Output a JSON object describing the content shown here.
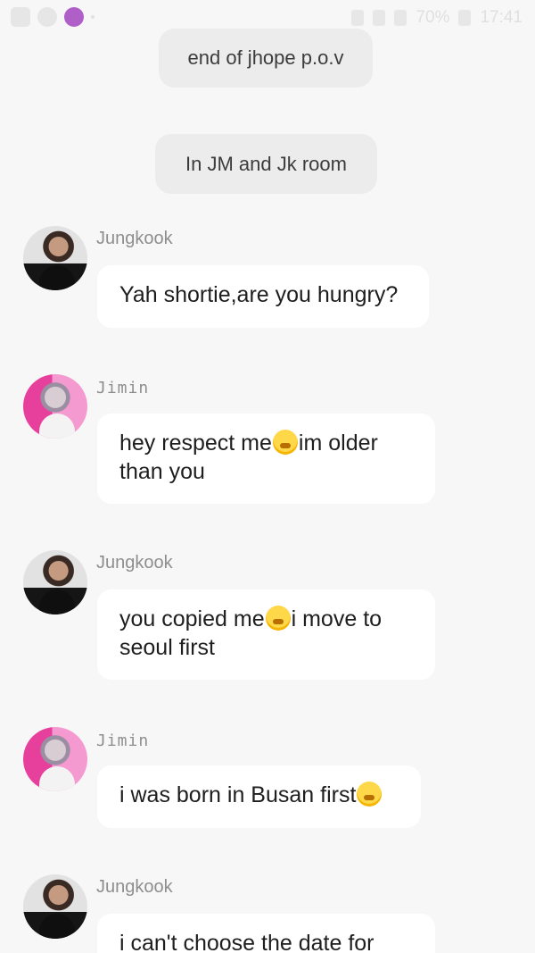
{
  "status_bar": {
    "icons": [
      "gallery-icon",
      "ring-icon",
      "app-icon"
    ],
    "battery": "70%",
    "time": "17:41",
    "right_icons": [
      "bluetooth-icon",
      "wifi-icon",
      "signal-icon",
      "battery-icon"
    ]
  },
  "narration": [
    "end of jhope p.o.v",
    "In JM and Jk room"
  ],
  "messages": [
    {
      "sender": "Jungkook",
      "avatar": "jungkook-avatar",
      "before": "Yah shortie,are you hungry?",
      "emoji": "",
      "after": ""
    },
    {
      "sender": "Jimin",
      "avatar": "jimin-avatar",
      "before": "hey respect me",
      "emoji": "huffing-face-emoji",
      "after": "im older than you"
    },
    {
      "sender": "Jungkook",
      "avatar": "jungkook-avatar",
      "before": "you copied me",
      "emoji": "huffing-face-emoji",
      "after": "i move to seoul first"
    },
    {
      "sender": "Jimin",
      "avatar": "jimin-avatar",
      "before": "i was born in Busan first",
      "emoji": "huffing-face-emoji",
      "after": ""
    },
    {
      "sender": "Jungkook",
      "avatar": "jungkook-avatar",
      "before": "i can't choose the date for",
      "emoji": "",
      "after": ""
    }
  ]
}
